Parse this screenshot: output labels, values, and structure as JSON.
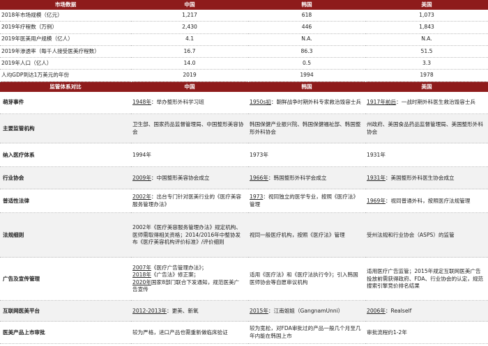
{
  "market": {
    "headers": [
      "市场数据",
      "中国",
      "韩国",
      "美国"
    ],
    "rows": [
      {
        "label": "2018年市场规模（亿元）",
        "cn": "1,217",
        "kr": "618",
        "us": "1,073"
      },
      {
        "label": "2019年疗程数（万例）",
        "cn": "2,430",
        "kr": "446",
        "us": "1,843"
      },
      {
        "label": "2019年医美用户规模（亿人）",
        "cn": "4.1",
        "kr": "N.A.",
        "us": "N.A."
      },
      {
        "label": "2019年渗透率（每千人接受医美疗程数）",
        "cn": "16.7",
        "kr": "86.3",
        "us": "51.5"
      },
      {
        "label": "2019年人口（亿人）",
        "cn": "14.0",
        "kr": "0.5",
        "us": "3.3"
      },
      {
        "label": "人均GDP到达1万美元的年份",
        "cn": "2019",
        "kr": "1994",
        "us": "1978"
      }
    ]
  },
  "regulation": {
    "headers": [
      "监管体系对比",
      "中国",
      "韩国",
      "美国"
    ],
    "rows": [
      {
        "label": "萌芽事件",
        "cn": {
          "u": "1948年",
          "t": "：举办整形外科学习班"
        },
        "kr": {
          "u": "1950s初",
          "t": "：朝鲜战争时期外科专家救治毁容士兵"
        },
        "us": {
          "u": "1917年前后",
          "t": "：一战时期外科医生救治毁容士兵"
        }
      },
      {
        "label": "主要监管机构",
        "cn": {
          "u": "",
          "t": "卫生部、国家药品监督管理局、中国整形美容协会"
        },
        "kr": {
          "u": "",
          "t": "韩国保健产业振兴院、韩国保健福祉部、韩国整形外科协会"
        },
        "us": {
          "u": "",
          "t": "州政府、美国食品药品监督管理局、美国整形外科协会"
        }
      },
      {
        "label": "纳入医疗体系",
        "cn": {
          "u": "",
          "t": "1994年"
        },
        "kr": {
          "u": "",
          "t": "1973年"
        },
        "us": {
          "u": "",
          "t": "1931年"
        }
      },
      {
        "label": "行业协会",
        "cn": {
          "u": "2009年",
          "t": "：中国整形美容协会成立"
        },
        "kr": {
          "u": "1966年",
          "t": "：韩国整形外科学会成立"
        },
        "us": {
          "u": "1931年",
          "t": "：美国整形外科医生协会成立"
        }
      },
      {
        "label": "普适性法律",
        "cn": {
          "u": "2002年",
          "t": "：出台专门针对医美行业的《医疗美容服务管理办法》"
        },
        "kr": {
          "u": "1973",
          "t": "：视同独立的医学专业，按照《医疗法》管理"
        },
        "us": {
          "u": "1969年",
          "t": "：视同普通外科，按照医疗法规管理"
        }
      },
      {
        "label": "法规细则",
        "cn": {
          "u": "",
          "t": "2002年《医疗美容服务管理办法》规定机构、医师需取得相关资格；2014/2016年中整协发布《医疗美容机构评价标准》/评价细则"
        },
        "kr": {
          "u": "",
          "t": "视同一般医疗机构，按照《医疗法》管理"
        },
        "us": {
          "u": "",
          "t": "受州法规和行业协会（ASPS）的监管"
        }
      },
      {
        "label": "广告及宣传管理",
        "cn": {
          "u": "2007年",
          "t": "《医疗广告管理办法》；",
          "u2": "2018年",
          "t2": "《广告法》修正案；",
          "u3": "2020年",
          "t3": "国家8部门联合下发通知，规范医美广告宣传"
        },
        "kr": {
          "u": "",
          "t": "适用《医疗法》和《医疗法执行令》；引入韩国医师协会等自愿审议机构"
        },
        "us": {
          "u": "",
          "t": "适用医疗广告监管；2015年规定互联网医美广告投放前需获得政府、FDA、行业协会的认定，规范搜索引擎竞价排名结果"
        }
      },
      {
        "label": "互联网医美平台",
        "cn": {
          "u": "2012-2013年",
          "t": "：更美、新氧"
        },
        "kr": {
          "u": "2015年",
          "t": "：江南姐姐（GangnamUnni）"
        },
        "us": {
          "u": "2006年",
          "t": "：Realself"
        }
      },
      {
        "label": "医美产品上市审批",
        "cn": {
          "u": "",
          "t": "较为严格，进口产品也需重新做临床验证"
        },
        "kr": {
          "u": "",
          "t": "较为宽松，对FDA审批过的产品一般几个月至几年内能在韩国上市"
        },
        "us": {
          "u": "",
          "t": "审批流程约1-2年"
        }
      }
    ]
  }
}
